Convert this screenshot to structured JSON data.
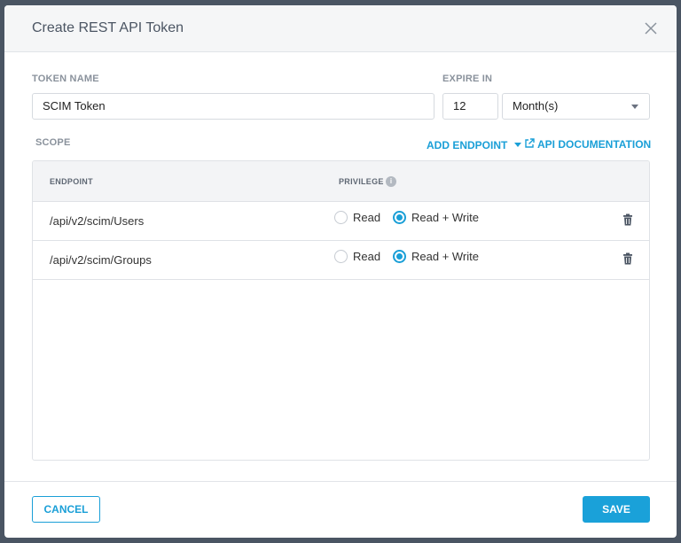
{
  "dialog": {
    "title": "Create REST API Token"
  },
  "form": {
    "token_name_label": "TOKEN NAME",
    "token_name_value": "SCIM Token",
    "expire_label": "EXPIRE IN",
    "expire_value": "12",
    "expire_unit": "Month(s)"
  },
  "scope": {
    "label": "SCOPE",
    "add_endpoint_label": "ADD ENDPOINT",
    "api_docs_label": "API DOCUMENTATION"
  },
  "table": {
    "col_endpoint": "ENDPOINT",
    "col_privilege": "PRIVILEGE",
    "info_glyph": "i",
    "rows": [
      {
        "endpoint": "/api/v2/scim/Users",
        "read_label": "Read",
        "readwrite_label": "Read + Write",
        "selected": "readwrite"
      },
      {
        "endpoint": "/api/v2/scim/Groups",
        "read_label": "Read",
        "readwrite_label": "Read + Write",
        "selected": "readwrite"
      }
    ]
  },
  "footer": {
    "cancel_label": "CANCEL",
    "save_label": "SAVE"
  },
  "colors": {
    "accent": "#1a9fd7",
    "backdrop": "#4a5563"
  },
  "icons": [
    "close-icon",
    "dropdown-caret-icon",
    "external-link-icon",
    "info-icon",
    "trash-icon"
  ]
}
